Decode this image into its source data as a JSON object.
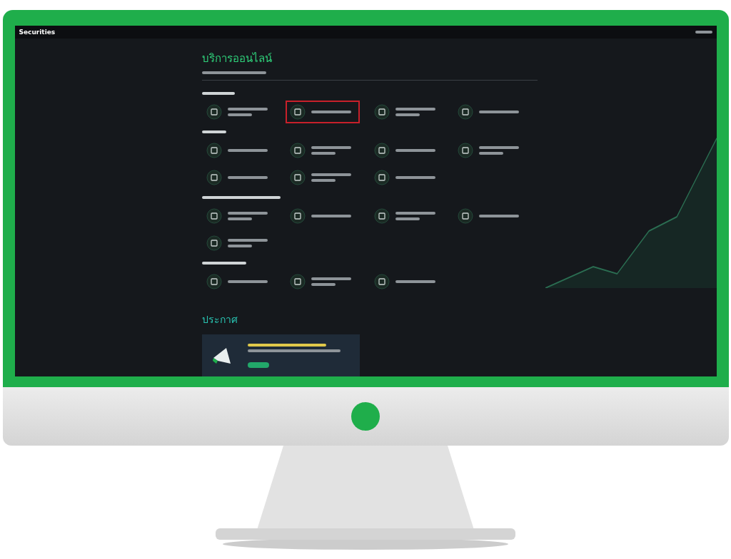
{
  "app": {
    "logo": "Securities"
  },
  "page": {
    "title": "บริการออนไลน์"
  },
  "sections": [
    {
      "items": [
        {
          "highlighted": false
        },
        {
          "highlighted": true
        },
        {
          "highlighted": false
        },
        {
          "highlighted": false
        }
      ]
    },
    {
      "items": [
        {
          "highlighted": false
        },
        {
          "highlighted": false
        },
        {
          "highlighted": false
        },
        {
          "highlighted": false
        },
        {
          "highlighted": false
        },
        {
          "highlighted": false
        },
        {
          "highlighted": false
        }
      ]
    },
    {
      "items": [
        {
          "highlighted": false
        },
        {
          "highlighted": false
        },
        {
          "highlighted": false
        },
        {
          "highlighted": false
        },
        {
          "highlighted": false
        }
      ]
    },
    {
      "items": [
        {
          "highlighted": false
        },
        {
          "highlighted": false
        },
        {
          "highlighted": false
        }
      ]
    }
  ],
  "announcements": {
    "title": "ประกาศ"
  }
}
